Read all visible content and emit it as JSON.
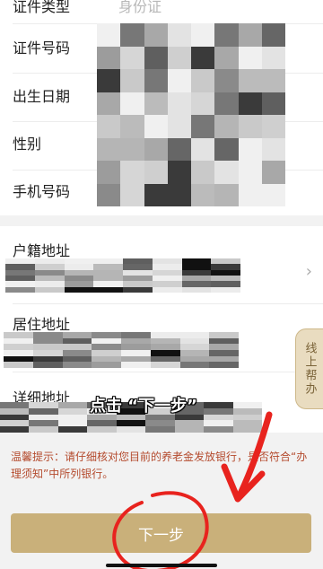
{
  "form": {
    "id_type": {
      "label": "证件类型",
      "value": "身份证"
    },
    "id_number": {
      "label": "证件号码"
    },
    "birth_date": {
      "label": "出生日期"
    },
    "gender": {
      "label": "性别"
    },
    "phone": {
      "label": "手机号码"
    }
  },
  "address": {
    "household": {
      "label": "户籍地址"
    },
    "residence": {
      "label": "居住地址"
    },
    "detail": {
      "label": "详细地址"
    }
  },
  "help_tab": {
    "label": "线上帮办"
  },
  "overlay_caption": "点击 “下一步”",
  "tip": "温馨提示：请仔细核对您目前的养老金发放银行，是否符合“办理须知”中所列银行。",
  "next_button": {
    "label": "下一步"
  },
  "colors": {
    "accent": "#c9b07a",
    "tip": "#b44a2d",
    "annotation": "#e8231e"
  },
  "icons": [
    "chevron-right-icon"
  ]
}
